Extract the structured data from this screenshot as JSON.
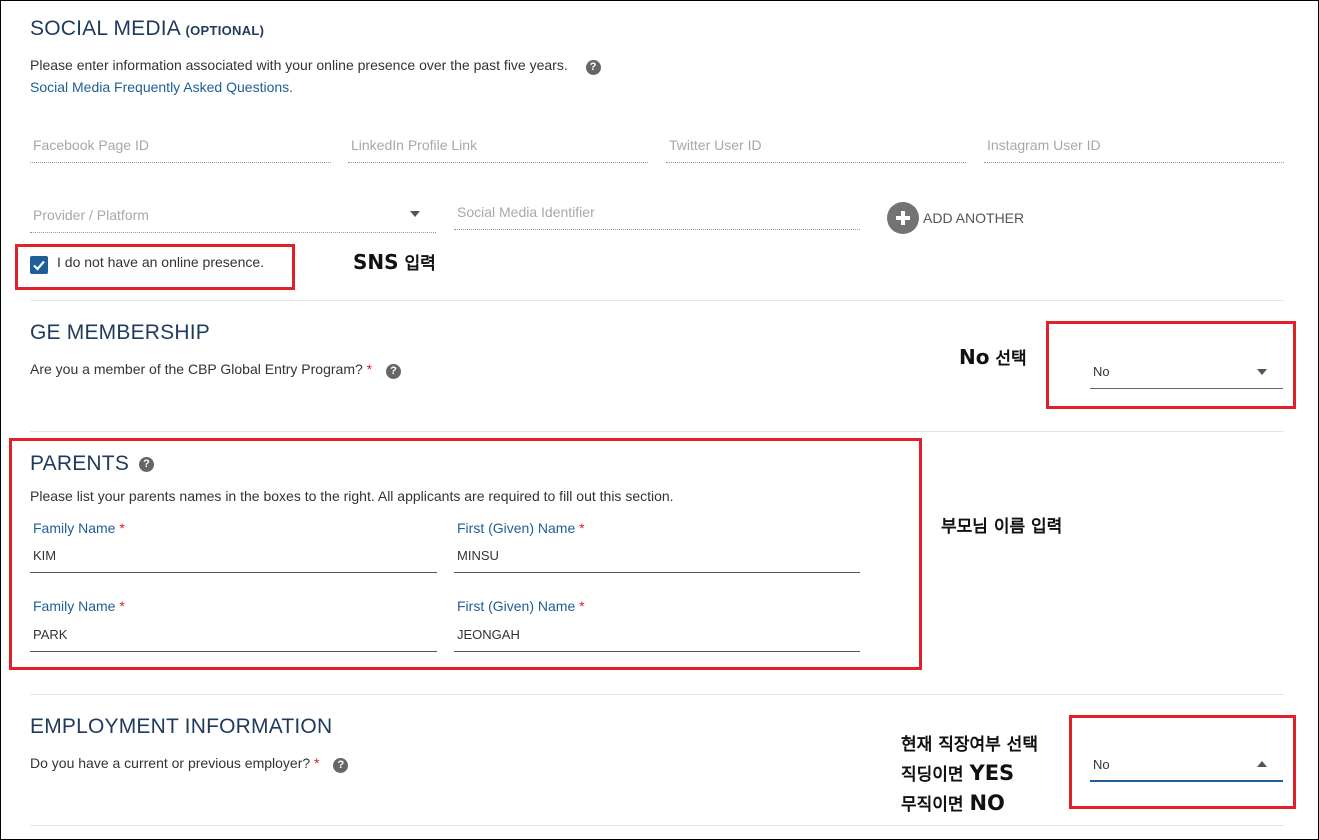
{
  "social": {
    "title": "SOCIAL MEDIA",
    "optional": "(OPTIONAL)",
    "description": "Please enter information associated with your online presence over the past five years.",
    "faq_link": "Social Media Frequently Asked Questions.",
    "fields": {
      "facebook": "Facebook Page ID",
      "linkedin": "LinkedIn Profile Link",
      "twitter": "Twitter User ID",
      "instagram": "Instagram User ID",
      "provider": "Provider / Platform",
      "identifier": "Social Media Identifier"
    },
    "add_another": "ADD ANOTHER",
    "no_presence_label": "I do not have an online presence.",
    "no_presence_checked": true
  },
  "ge": {
    "title": "GE MEMBERSHIP",
    "question": "Are you a member of the CBP Global Entry Program?",
    "required_mark": "*",
    "value": "No"
  },
  "parents": {
    "title": "PARENTS",
    "description": "Please list your parents names in the boxes to the right. All applicants are required to fill out this section.",
    "family_label": "Family Name",
    "given_label": "First (Given) Name",
    "required_mark": "*",
    "entries": [
      {
        "family": "KIM",
        "given": "MINSU"
      },
      {
        "family": "PARK",
        "given": "JEONGAH"
      }
    ]
  },
  "employment": {
    "title": "EMPLOYMENT INFORMATION",
    "question": "Do you have a current or previous employer?",
    "required_mark": "*",
    "value": "No"
  },
  "annotations": {
    "sns": {
      "bold": "SNS",
      "rest": " 입력"
    },
    "ge": {
      "bold": "No",
      "rest": " 선택"
    },
    "parents": "부모님 이름 입력",
    "employment_line1": "현재 직장여부 선택",
    "employment_line2": {
      "prefix": "직딩이면 ",
      "bold": "YES"
    },
    "employment_line3": {
      "prefix": "무직이면 ",
      "bold": "NO"
    }
  },
  "help_glyph": "?",
  "colors": {
    "title": "#1f3a5c",
    "link": "#1f5e96",
    "required": "#d9222a",
    "annotation_box": "#e0202a",
    "checkbox": "#1f5e96"
  }
}
